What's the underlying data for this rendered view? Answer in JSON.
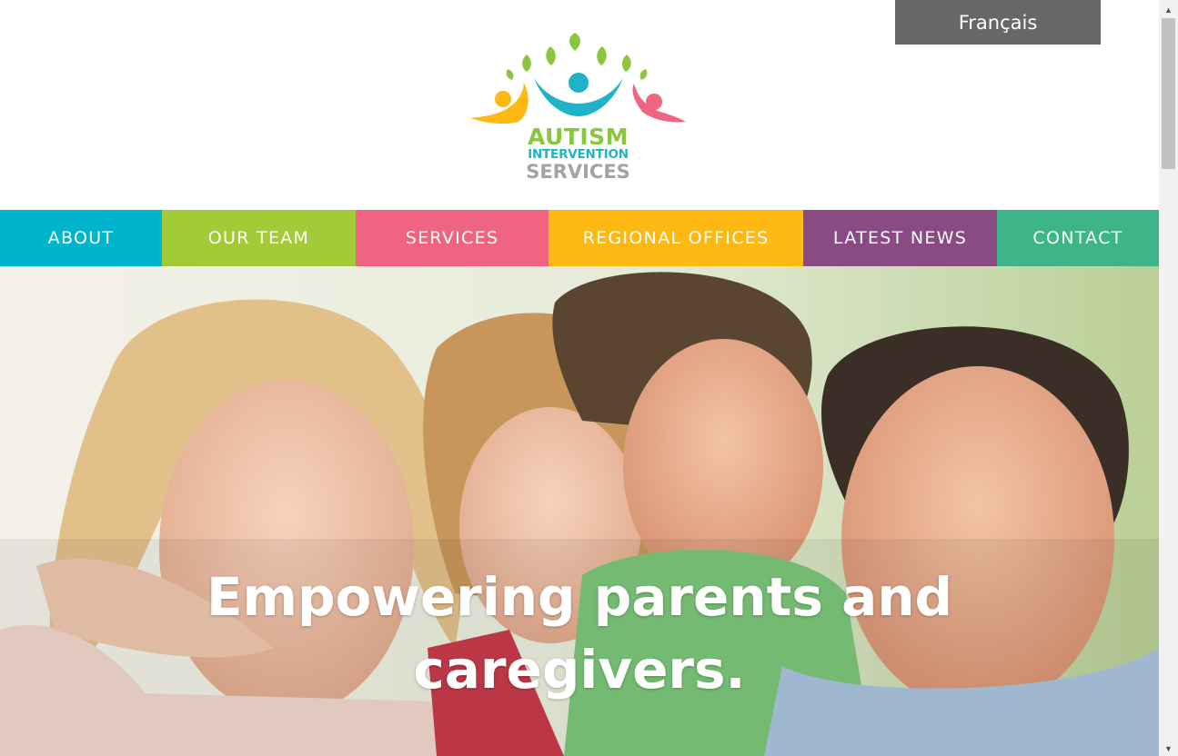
{
  "language_toggle": {
    "label": "Français"
  },
  "logo": {
    "line1": "AUTISM",
    "line2": "INTERVENTION",
    "line3": "SERVICES"
  },
  "nav": {
    "items": [
      {
        "label": "ABOUT",
        "color": "#00b4cd"
      },
      {
        "label": "OUR TEAM",
        "color": "#a3cb38"
      },
      {
        "label": "SERVICES",
        "color": "#ef6480"
      },
      {
        "label": "REGIONAL OFFICES",
        "color": "#fdb813"
      },
      {
        "label": "LATEST NEWS",
        "color": "#8a4a83"
      },
      {
        "label": "CONTACT",
        "color": "#3eb489"
      }
    ]
  },
  "hero": {
    "heading_line1": "Empowering parents and",
    "heading_line2": "caregivers."
  },
  "icons": {
    "scroll_up": "triangle-up-icon",
    "scroll_down": "triangle-down-icon"
  }
}
